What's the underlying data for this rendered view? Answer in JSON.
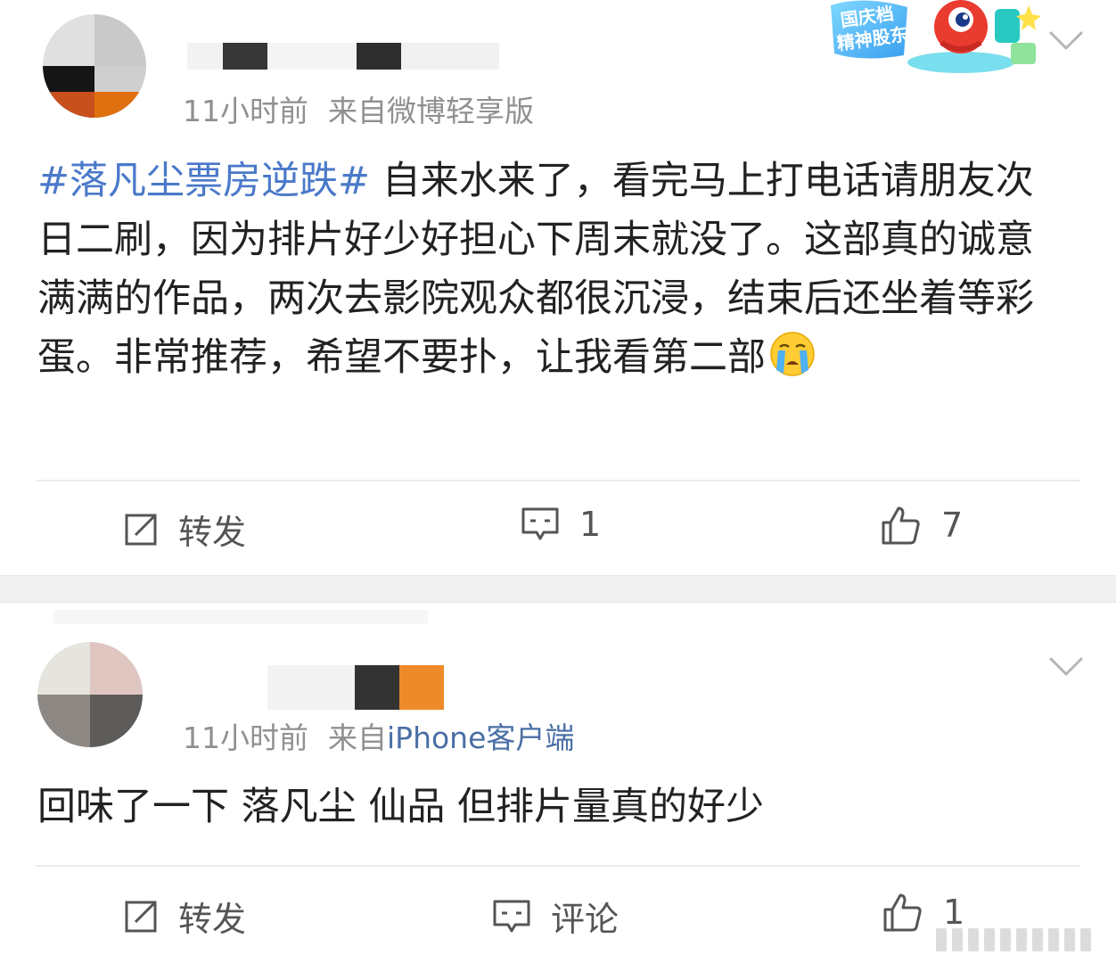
{
  "posts": [
    {
      "time": "11小时前",
      "source_prefix": "来自",
      "source": "微博轻享版",
      "topic": "#落凡尘票房逆跌#",
      "body": " 自来水来了，看完马上打电话请朋友次日二刷，因为排片好少好担心下周末就没了。这部真的诚意满满的作品，两次去影院观众都很沉浸，结束后还坐着等彩蛋。非常推荐，希望不要扑，让我看第二部",
      "emoji": "crying-face",
      "badge_text": [
        "国庆档",
        "精神股东"
      ],
      "actions": {
        "repost": "转发",
        "comment": "1",
        "like": "7"
      }
    },
    {
      "time": "11小时前",
      "source_prefix": "来自",
      "source": "iPhone客户端",
      "body": "回味了一下 落凡尘 仙品 但排片量真的好少",
      "actions": {
        "repost": "转发",
        "comment": "评论",
        "like": "1"
      }
    }
  ],
  "icons": {
    "repost": "share-edit-icon",
    "comment": "comment-bubble-icon",
    "like": "thumbs-up-icon",
    "menu": "chevron-down-icon"
  },
  "colors": {
    "topic": "#4a79c9",
    "source_link": "#4a6fa5",
    "meta": "#909090",
    "text": "#222222"
  }
}
